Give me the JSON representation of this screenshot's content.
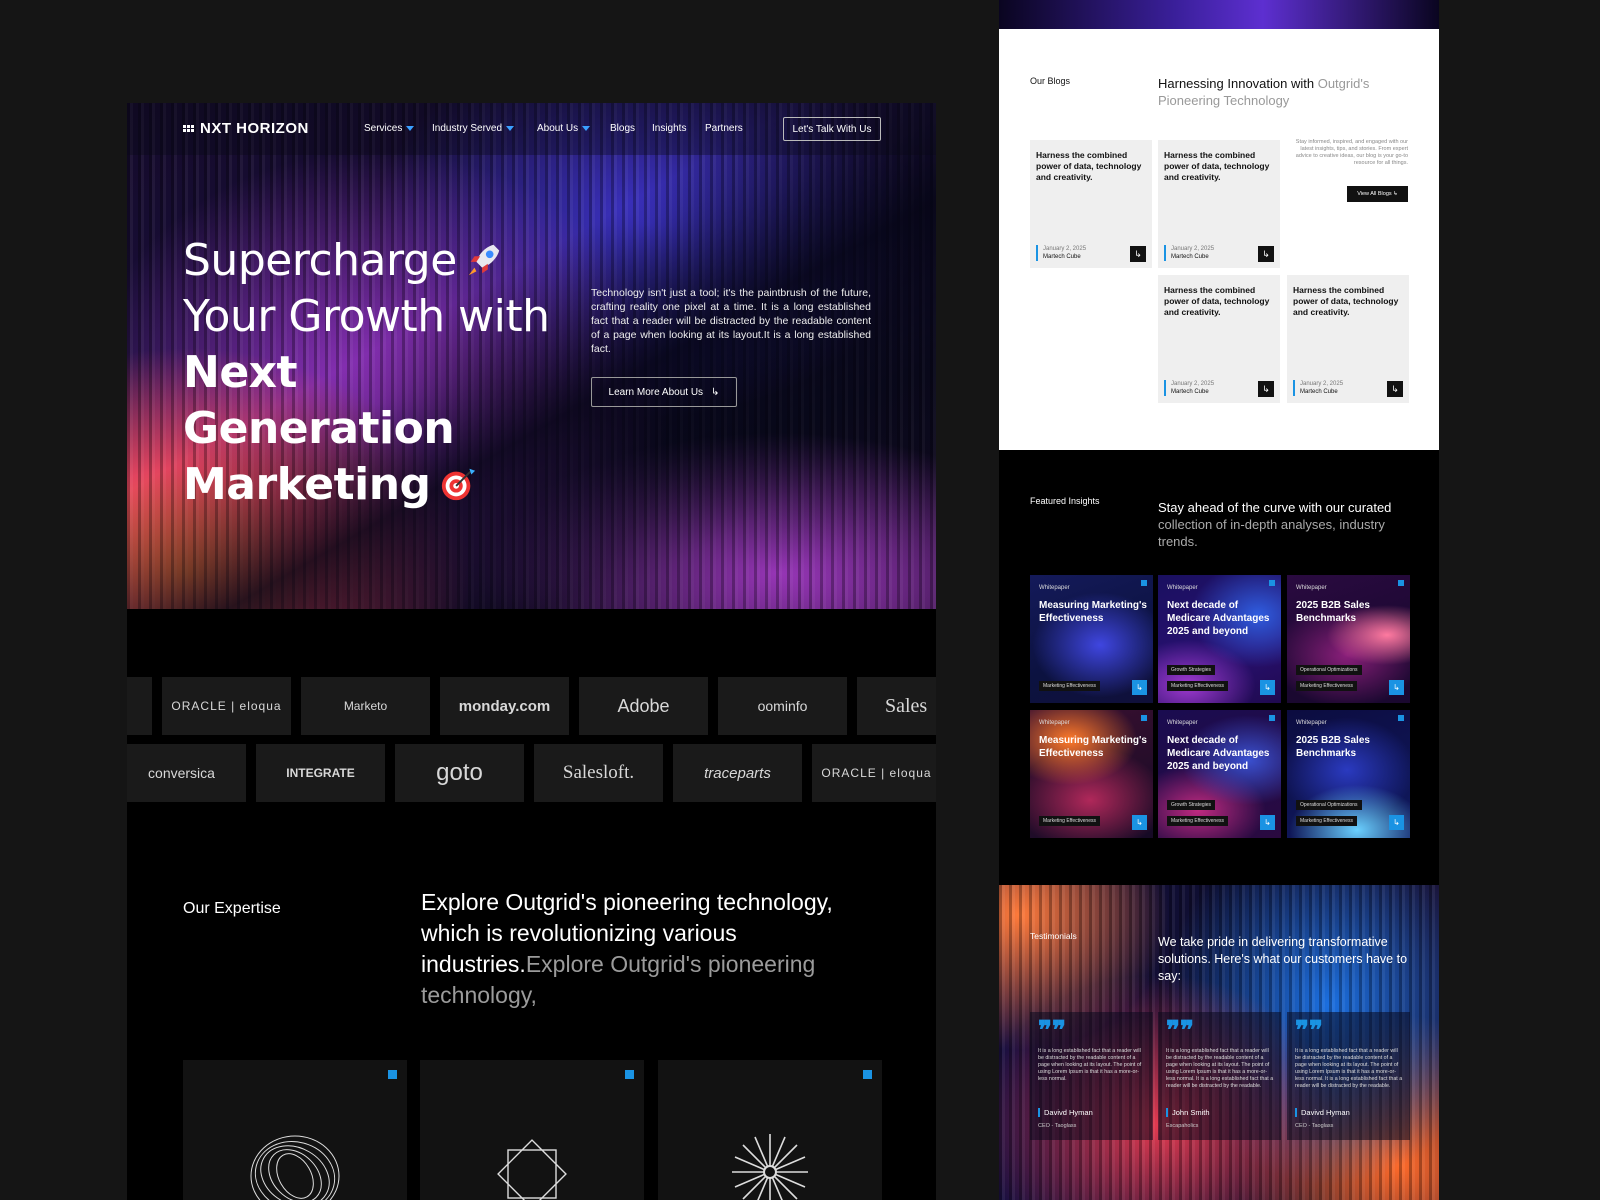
{
  "brand": {
    "name": "NXT HORIZON"
  },
  "nav": {
    "items": [
      "Services",
      "Industry Served",
      "About Us",
      "Blogs",
      "Insights",
      "Partners"
    ],
    "cta": "Let's Talk With Us"
  },
  "hero": {
    "line1": "Supercharge",
    "line2": "Your Growth with",
    "line3": "Next Generation",
    "line4": "Marketing",
    "text": "Technology isn't just a tool; it's the paintbrush of the future, crafting reality one pixel at a time. It is a long established fact that a reader will be distracted by the readable content of a page when looking at its layout.It is a long established fact.",
    "button": "Learn More About Us"
  },
  "logos": {
    "row1": [
      "",
      "ORACLE | eloqua",
      "Marketo",
      "monday.com",
      "Adobe",
      "oominfo",
      "Sales"
    ],
    "row2": [
      "conversica",
      "INTEGRATE",
      "goto",
      "Salesloft.",
      "traceparts",
      "ORACLE | eloqua"
    ]
  },
  "expertise": {
    "title": "Our Expertise",
    "text_main": "Explore Outgrid's pioneering technology, which is revolutionizing various industries.",
    "text_muted": "Explore Outgrid's pioneering technology,"
  },
  "blogs": {
    "label": "Our Blogs",
    "heading_main": "Harnessing Innovation with ",
    "heading_muted": "Outgrid's Pioneering Technology",
    "intro": "Stay informed, inspired, and engaged with our latest insights, tips, and stories. From expert advice to creative ideas, our blog is your go-to resource for all things.",
    "view_all": "View All Blogs",
    "cards": [
      {
        "title": "Harness the combined power of data, technology and creativity.",
        "date": "January 2, 2025",
        "author": "Martech Cube"
      },
      {
        "title": "Harness the combined power of data, technology and creativity.",
        "date": "January 2, 2025",
        "author": "Martech Cube"
      },
      {
        "title": "Harness the combined power of data, technology and creativity.",
        "date": "January 2, 2025",
        "author": "Martech Cube"
      },
      {
        "title": "Harness the combined power of data, technology and creativity.",
        "date": "January 2, 2025",
        "author": "Martech Cube"
      }
    ]
  },
  "insights": {
    "label": "Featured Insights",
    "heading_main": "Stay ahead of the curve with our curated ",
    "heading_muted": "collection of in-depth analyses, industry trends.",
    "cards": [
      {
        "kind": "Whitepaper",
        "title": "Measuring Marketing's Effectiveness",
        "tags": [
          "Marketing Effectiveness"
        ]
      },
      {
        "kind": "Whitepaper",
        "title": "Next decade of Medicare Advantages 2025 and beyond",
        "tags": [
          "Growth Strategies",
          "Marketing Effectiveness"
        ]
      },
      {
        "kind": "Whitepaper",
        "title": "2025 B2B Sales Benchmarks",
        "tags": [
          "Operational Optimizations",
          "Marketing Effectiveness"
        ]
      },
      {
        "kind": "Whitepaper",
        "title": "Measuring Marketing's Effectiveness",
        "tags": [
          "Marketing Effectiveness"
        ]
      },
      {
        "kind": "Whitepaper",
        "title": "Next decade of Medicare Advantages 2025 and beyond",
        "tags": [
          "Growth Strategies",
          "Marketing Effectiveness"
        ]
      },
      {
        "kind": "Whitepaper",
        "title": "2025 B2B Sales Benchmarks",
        "tags": [
          "Operational Optimizations",
          "Marketing Effectiveness"
        ]
      }
    ]
  },
  "testimonials": {
    "label": "Testimonials",
    "heading": "We take pride in delivering transformative solutions. Here's what our customers have to say:",
    "cards": [
      {
        "text": "It is a long established fact that a reader will be distracted by the readable content of a page when looking at its layout. The point of using Lorem Ipsum is that it has a more-or-less normal.",
        "name": "Davivd Hyman",
        "role": "CEO - Taoglass"
      },
      {
        "text": "It is a long established fact that a reader will be distracted by the readable content of a page when looking at its layout. The point of using Lorem Ipsum is that it has a more-or-less normal. It is a long established fact that a reader will be distracted by the readable.",
        "name": "John Smith",
        "role": "Escapaholics"
      },
      {
        "text": "It is a long established fact that a reader will be distracted by the readable content of a page when looking at its layout. The point of using Lorem Ipsum is that it has a more-or-less normal. It is a long established fact that a reader will be distracted by the readable.",
        "name": "Davivd Hyman",
        "role": "CEO - Taoglass"
      }
    ]
  },
  "colors": {
    "accent": "#1a93e3",
    "background": "#151515"
  }
}
